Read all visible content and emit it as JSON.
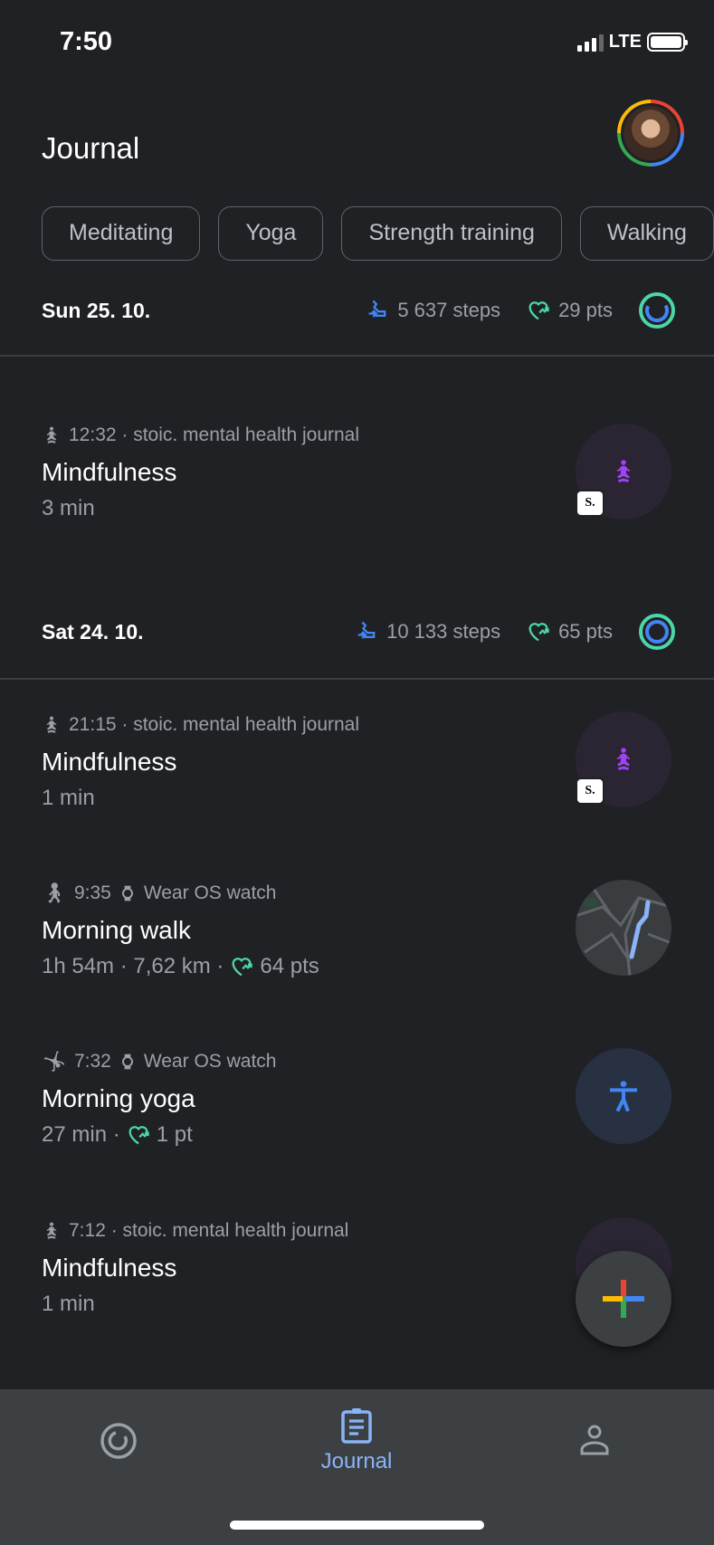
{
  "status_bar": {
    "time": "7:50",
    "network": "LTE",
    "signal_bars": 3,
    "battery_level": 0.95
  },
  "header": {
    "title": "Journal"
  },
  "chips": [
    "Meditating",
    "Yoga",
    "Strength training",
    "Walking"
  ],
  "colors": {
    "steps": "#4285f4",
    "points": "#4cd6a8",
    "accent": "#8ab4f8",
    "mindfulness": "#a142f4"
  },
  "days": [
    {
      "date": "Sun 25. 10.",
      "steps": "5 637 steps",
      "points": "29 pts",
      "items": [
        {
          "time": "12:32 · stoic. mental health journal",
          "title": "Mindfulness",
          "subtitle": "3 min",
          "icon": "meditation-icon",
          "source_badge": "S."
        }
      ]
    },
    {
      "date": "Sat 24. 10.",
      "steps": "10 133 steps",
      "points": "65 pts",
      "items": [
        {
          "time": "21:15 · stoic. mental health journal",
          "title": "Mindfulness",
          "subtitle": "1 min",
          "icon": "meditation-icon",
          "source_badge": "S."
        },
        {
          "time": "9:35",
          "source": "Wear OS watch",
          "title": "Morning walk",
          "subtitle": "1h 54m · 7,62 km ·",
          "points": "64 pts",
          "icon": "walking-icon"
        },
        {
          "time": "7:32",
          "source": "Wear OS watch",
          "title": "Morning yoga",
          "subtitle": "27 min ·",
          "points": "1 pt",
          "icon": "yoga-icon"
        },
        {
          "time": "7:12 · stoic. mental health journal",
          "title": "Mindfulness",
          "subtitle": "1 min",
          "icon": "meditation-icon"
        }
      ]
    }
  ],
  "bottom_nav": {
    "items": [
      {
        "icon": "home-ring-icon"
      },
      {
        "label": "Journal",
        "icon": "journal-icon",
        "active": true
      },
      {
        "icon": "profile-icon"
      }
    ]
  }
}
